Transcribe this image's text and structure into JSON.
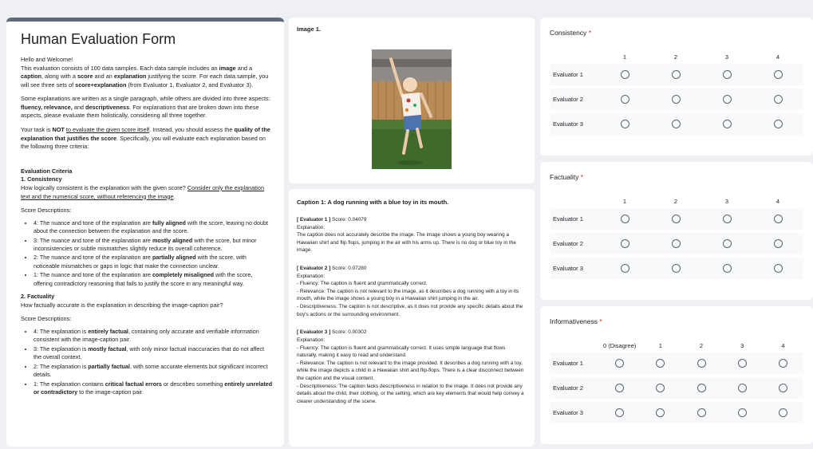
{
  "form": {
    "title": "Human Evaluation Form",
    "intro": {
      "p1_line1": "Hello and Welcome!",
      "p1_a": "This evaluation consists of 100 data samples. Each data sample includes an ",
      "p1_image": "image",
      "p1_b": " and a ",
      "p1_caption": "caption",
      "p1_c": ", along with a ",
      "p1_score": "score",
      "p1_d": " and an ",
      "p1_explanation": "explanation",
      "p1_e": " justifying the score. For each data sample, you will see three sets of ",
      "p1_se": "score+explanation",
      "p1_f": " (from Evaluator 1, Evaluator 2, and Evaluator 3).",
      "p2_a": "Some explanations are written as a single paragraph, while others are divided into three aspects: ",
      "p2_aspects": "fluency, relevance,",
      "p2_b": " and ",
      "p2_desc": "descriptiveness",
      "p2_c": ". For explanations that are broken down into these aspects, please evaluate them holistically, considering all three together.",
      "p3_a": "Your task is ",
      "p3_not": "NOT",
      "p3_u": "to evaluate the given score itself",
      "p3_b": ". Instead, you should assess the ",
      "p3_quality": "quality of the explanation that justifies the score",
      "p3_c": ". Specifically, you will evaluate each explanation based on the following three criteria:"
    },
    "criteria_title": "Evaluation Criteria",
    "c1": {
      "title": "1. Consistency",
      "q_a": "How logically consistent is the explanation with the given score? ",
      "q_u": "Consider only the explanation text and the numerical score, without referencing the image",
      "q_b": ".",
      "desc_label": "Score Descriptions:",
      "items": [
        {
          "a": "4: The nuance and tone of the explanation are ",
          "b": "fully aligned",
          "c": " with the score, leaving no doubt about the connection between the explanation and the score."
        },
        {
          "a": "3: The nuance and tone of the explanation are ",
          "b": "mostly aligned",
          "c": " with the score, but minor inconsistencies or subtle mismatches slightly reduce its overall coherence."
        },
        {
          "a": "2: The nuance and tone of the explanation are ",
          "b": "partially aligned",
          "c": " with the score, with noticeable mismatches or gaps in logic that make the connection unclear."
        },
        {
          "a": "1: The nuance and tone of the explanation are ",
          "b": "completely misaligned",
          "c": " with the score, offering contradictory reasoning that fails to justify the score in any meaningful way."
        }
      ]
    },
    "c2": {
      "title": "2. Factuality",
      "q": "How factually accurate is the explanation in describing the image-caption pair?",
      "desc_label": "Score Descriptions:",
      "items": [
        {
          "a": "4: The explanation is ",
          "b": "entirely factual",
          "c": ", containing only accurate and verifiable information consistent with the image-caption pair."
        },
        {
          "a": "3: The explanation is ",
          "b": "mostly factual",
          "c": ", with only minor factual inaccuracies that do not affect the overall context."
        },
        {
          "a": "2: The explanation is ",
          "b": "partially factual",
          "c": ", with some accurate elements but significant incorrect details."
        },
        {
          "a": "1: The explanation contains ",
          "b": "critical factual errors",
          "c": " or describes something ",
          "d": "entirely unrelated or contradictory",
          "e": " to the image-caption pair."
        }
      ]
    }
  },
  "image_panel": {
    "label": "Image 1."
  },
  "caption_panel": {
    "title": "Caption 1: A dog running with a blue toy in its mouth.",
    "evaluators": [
      {
        "tag": "[ Evaluator 1 ]",
        "score": "Score: 0.04079",
        "lines": [
          "Explanation:",
          "The caption does not accurately describe the image. The image shows a young boy wearing a Hawaiian shirt and flip flops, jumping in the air with his arms up. There is no dog or blue toy in the image."
        ]
      },
      {
        "tag": "[ Evaluator 2 ]",
        "score": "Score: 0.07280",
        "lines": [
          "Explanation:",
          "- Fluency: The caption is fluent and grammatically correct.",
          "- Relevance: The caption is not relevant to the image, as it describes a dog running with a toy in its mouth, while the image shows a young boy in a Hawaiian shirt jumping in the air.",
          "- Descriptiveness: The caption is not descriptive, as it does not provide any specific details about the boy's actions or the surrounding environment."
        ]
      },
      {
        "tag": "[ Evaluator 3 ]",
        "score": "Score: 0.00302",
        "lines": [
          "Explanation:",
          "- Fluency: The caption is fluent and grammatically correct. It uses simple language that flows naturally, making it easy to read and understand.",
          "- Relevance: The caption is not relevant to the image provided. It describes a dog running with a toy, while the image depicts a child in a Hawaiian shirt and flip-flops. There is a clear disconnect between the caption and the visual content.",
          "- Descriptiveness: The caption lacks descriptiveness in relation to the image. It does not provide any details about the child, their clothing, or the setting, which are key elements that would help convey a clearer understanding of the scene."
        ]
      }
    ]
  },
  "questions": [
    {
      "title": "Consistency",
      "required": "*",
      "columns": [
        "1",
        "2",
        "3",
        "4"
      ],
      "rows": [
        "Evaluator 1",
        "Evaluator 2",
        "Evaluator 3"
      ]
    },
    {
      "title": "Factuality",
      "required": "*",
      "columns": [
        "1",
        "2",
        "3",
        "4"
      ],
      "rows": [
        "Evaluator 1",
        "Evaluator 2",
        "Evaluator 3"
      ]
    },
    {
      "title": "Informativeness",
      "required": "*",
      "columns": [
        "0 (Disagree)",
        "1",
        "2",
        "3",
        "4"
      ],
      "rows": [
        "Evaluator 1",
        "Evaluator 2",
        "Evaluator 3"
      ]
    }
  ],
  "colors": {
    "accent_bar": "#5f6b79",
    "required": "#d93025",
    "page_bg": "#eef0f3"
  }
}
